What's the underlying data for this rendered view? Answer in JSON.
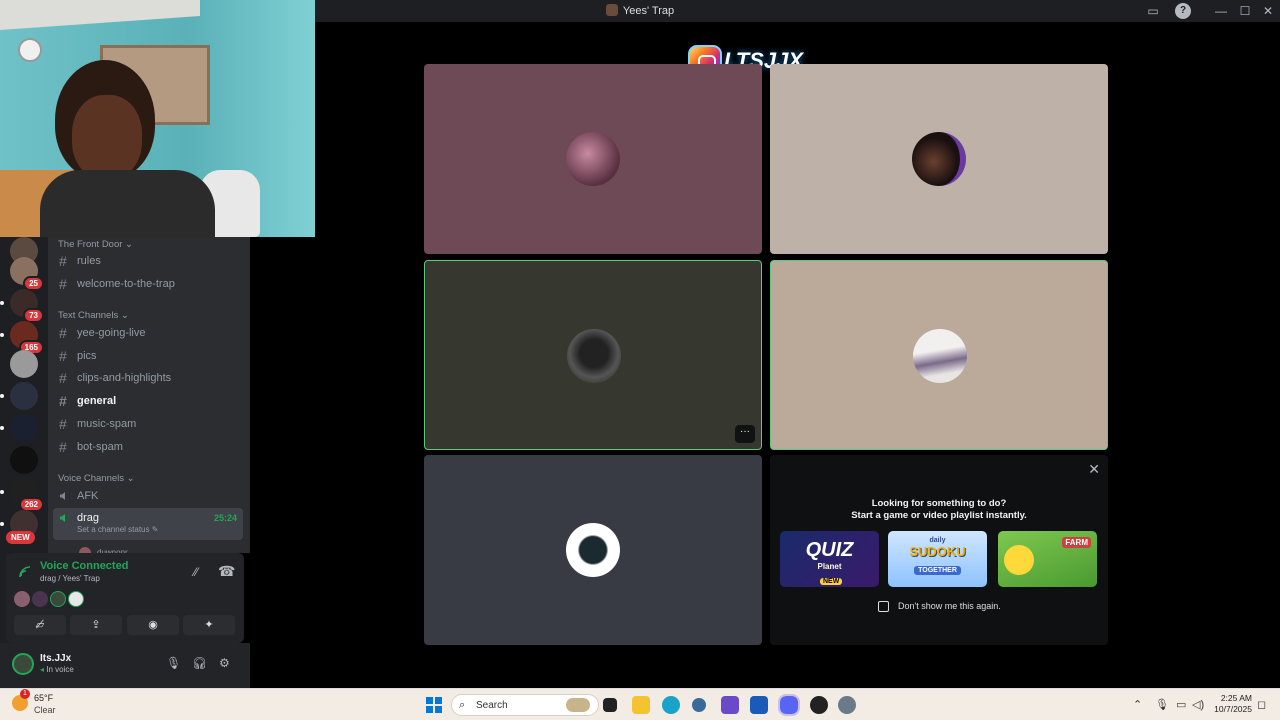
{
  "window": {
    "title": "Yees' Trap"
  },
  "overlay": {
    "instagram_handle": "LTSJJX"
  },
  "sidebar": {
    "guild_badges": [
      "25",
      "73",
      "165",
      "262"
    ],
    "new_badge": "NEW",
    "categories": {
      "front_door": "The Front Door",
      "text": "Text Channels",
      "voice": "Voice Channels"
    },
    "front_door_channels": [
      "rules",
      "welcome-to-the-trap"
    ],
    "text_channels": [
      "yee-going-live",
      "pics",
      "clips-and-highlights",
      "general",
      "music-spam",
      "bot-spam"
    ],
    "voice_channels": {
      "afk": "AFK",
      "drag": "drag",
      "drag_timer": "25:24",
      "drag_status": "Set a channel status",
      "member_partial": "duwnonr"
    }
  },
  "voice_panel": {
    "title": "Voice Connected",
    "subtitle": "drag / Yees' Trap"
  },
  "user": {
    "name": "Its.JJx",
    "status": "In voice"
  },
  "promo": {
    "line1": "Looking for something to do?",
    "line2": "Start a game or video playlist instantly.",
    "games": [
      "QUIZ",
      "Planet",
      "NEW",
      "daily",
      "SUDOKU",
      "TOGETHER",
      "FARM"
    ],
    "checkbox_label": "Don't show me this again."
  },
  "taskbar": {
    "weather_temp": "65°F",
    "weather_cond": "Clear",
    "weather_badge": "1",
    "search_placeholder": "Search",
    "time": "2:25 AM",
    "date": "10/7/2025"
  },
  "colors": {
    "accent_green": "#23a55a",
    "speaking_border": "#5ec97e",
    "badge_red": "#da373c",
    "sidebar_bg": "#2b2d31",
    "guild_bg": "#1e1f22"
  }
}
